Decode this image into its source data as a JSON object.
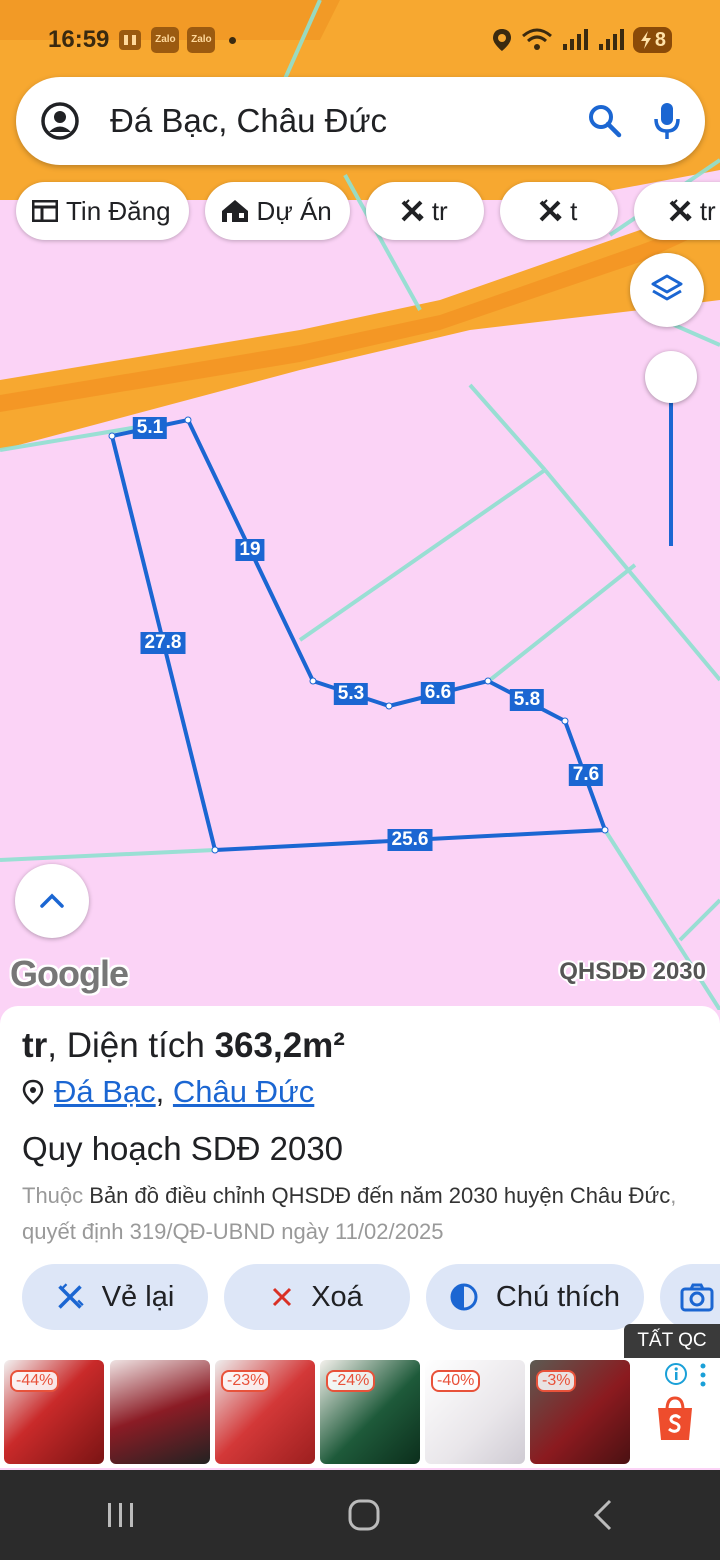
{
  "status": {
    "time": "16:59",
    "apps": [
      "Zalo",
      "Zalo"
    ],
    "battery": "8"
  },
  "search": {
    "query": "Đá Bạc, Châu Đức"
  },
  "chips": [
    {
      "label": "Tin Đăng",
      "icon": "newspaper-icon"
    },
    {
      "label": "Dự Án",
      "icon": "house-icon"
    },
    {
      "label": "tr",
      "icon": "pencil-ruler-icon"
    },
    {
      "label": "t",
      "icon": "pencil-ruler-icon"
    },
    {
      "label": "tr",
      "icon": "pencil-ruler-icon"
    }
  ],
  "map": {
    "segment_labels": [
      "5.1",
      "19",
      "27.8",
      "5.3",
      "6.6",
      "5.8",
      "7.6",
      "25.6"
    ],
    "logo": "Google",
    "plan_label": "QHSDĐ 2030",
    "colors": {
      "land": "#fbd3f6",
      "road": "#f7a830",
      "boundary": "#1b66d2",
      "parcel_lines": "#8fe0d0"
    }
  },
  "sheet": {
    "title_prefix": "tr",
    "title_mid": ", Diện tích ",
    "area": "363,2m²",
    "location_1": "Đá Bạc",
    "location_sep": ",",
    "location_2": "Châu Đức",
    "heading": "Quy hoạch SDĐ 2030",
    "desc_prefix": "Thuộc ",
    "desc_main": "Bản đồ điều chỉnh QHSDĐ đến năm 2030 huyện Châu Đức",
    "desc_suffix": ", quyết định 319/QĐ-UBND ngày 11/02/2025",
    "actions": [
      {
        "label": "Vẻ lại",
        "icon": "pencil-ruler-icon"
      },
      {
        "label": "Xoá",
        "icon": "close-icon"
      },
      {
        "label": "Chú thích",
        "icon": "contrast-icon"
      }
    ]
  },
  "ads": {
    "close_label": "TẤT QC",
    "discounts": [
      "-44%",
      "",
      "-23%",
      "-24%",
      "-40%",
      "-3%"
    ]
  }
}
